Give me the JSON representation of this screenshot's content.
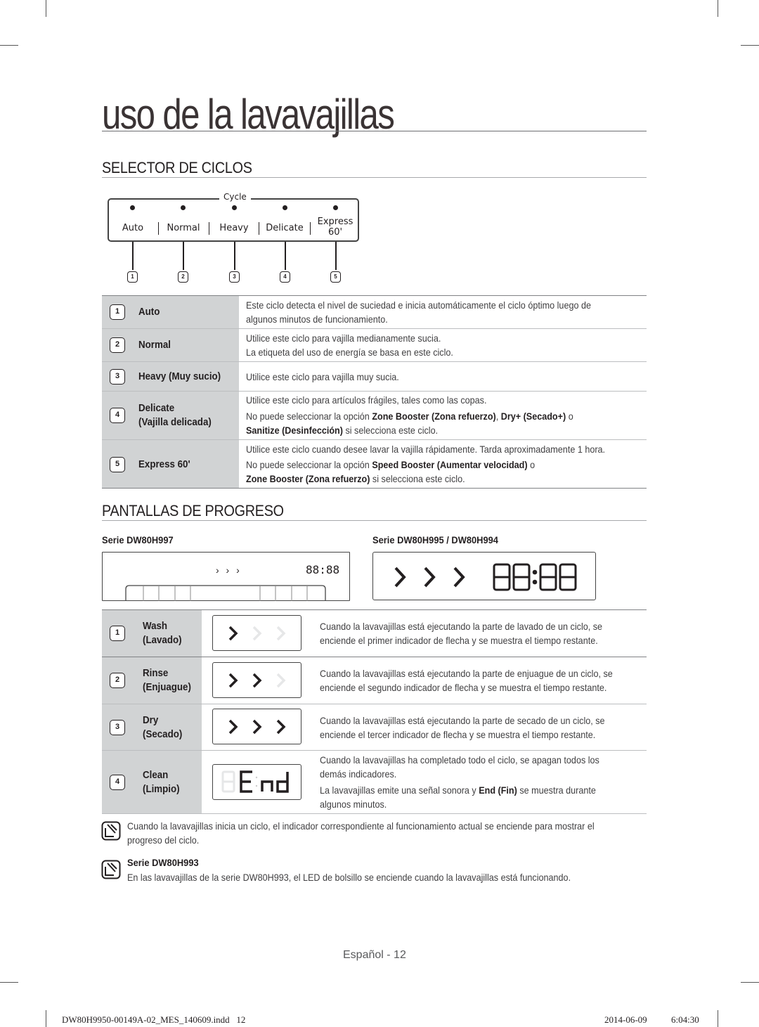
{
  "page": {
    "title": "uso de la lavavajillas",
    "footer_page": "Español - 12",
    "slug_file": "DW80H9950-00149A-02_MES_140609.indd   12",
    "slug_date": "2014-06-09",
    "slug_time": "6:04:30"
  },
  "selector": {
    "heading": "SELECTOR DE CICLOS",
    "panel_label": "Cycle",
    "buttons": [
      {
        "label": "Auto",
        "num": "1"
      },
      {
        "label": "Normal",
        "num": "2"
      },
      {
        "label": "Heavy",
        "num": "3"
      },
      {
        "label": "Delicate",
        "num": "4"
      },
      {
        "label": "Express",
        "label2": "60'",
        "num": "5"
      }
    ],
    "rows": [
      {
        "num": "1",
        "name": "Auto",
        "name2": "",
        "lines": [
          "Este ciclo detecta el nivel de suciedad e inicia automáticamente el ciclo óptimo luego de",
          "algunos minutos de funcionamiento."
        ]
      },
      {
        "num": "2",
        "name": "Normal",
        "name2": "",
        "lines": [
          "Utilice este ciclo para vajilla medianamente sucia.",
          "La etiqueta del uso de energía se basa en este ciclo."
        ]
      },
      {
        "num": "3",
        "name": "Heavy (Muy sucio)",
        "name2": "",
        "lines": [
          "Utilice este ciclo para vajilla muy sucia."
        ]
      },
      {
        "num": "4",
        "name": "Delicate",
        "name2": "(Vajilla delicada)",
        "lines": [
          "Utilice este ciclo para artículos frágiles, tales como las copas."
        ],
        "rich": {
          "l2_a": "No puede seleccionar la opción ",
          "l2_b": "Zone Booster (Zona refuerzo)",
          "l2_c": ", ",
          "l2_d": "Dry+ (Secado+)",
          "l2_e": " o",
          "l3_a": "Sanitize (Desinfección)",
          "l3_b": " si selecciona este ciclo."
        }
      },
      {
        "num": "5",
        "name": "Express 60'",
        "name2": "",
        "lines": [
          "Utilice este ciclo cuando desee lavar la vajilla rápidamente. Tarda aproximadamente 1 hora."
        ],
        "rich": {
          "l2_a": "No puede seleccionar la opción ",
          "l2_b": "Speed Booster (Aumentar velocidad)",
          "l2_c": " o",
          "l3_a": "Zone Booster (Zona refuerzo)",
          "l3_b": " si selecciona este ciclo."
        }
      }
    ]
  },
  "progress": {
    "heading": "PANTALLAS DE PROGRESO",
    "serie_a": "Serie DW80H997",
    "serie_b": "Serie DW80H995 / DW80H994",
    "display_small_arrows": "› › ›",
    "display_time": "88:88",
    "rows": [
      {
        "num": "1",
        "name": "Wash",
        "name2": "(Lavado)",
        "arrows_on": 1,
        "lines": [
          "Cuando la lavavajillas está ejecutando la parte de lavado de un ciclo, se",
          "enciende el primer indicador de flecha y se muestra el tiempo restante."
        ]
      },
      {
        "num": "2",
        "name": "Rinse",
        "name2": "(Enjuague)",
        "arrows_on": 2,
        "lines": [
          "Cuando la lavavajillas está ejecutando la parte de enjuague de un ciclo, se",
          "enciende el segundo indicador de flecha y se muestra el tiempo restante."
        ]
      },
      {
        "num": "3",
        "name": "Dry",
        "name2": "(Secado)",
        "arrows_on": 3,
        "lines": [
          "Cuando la lavavajillas está ejecutando la parte de secado de un ciclo, se",
          "enciende el tercer indicador de flecha y se muestra el tiempo restante."
        ]
      },
      {
        "num": "4",
        "name": "Clean",
        "name2": "(Limpio)",
        "display_text": "End",
        "lines": [
          "Cuando la lavavajillas ha completado todo el ciclo, se apagan todos los",
          "demás indicadores."
        ],
        "rich": {
          "a": "La lavavajillas emite una señal sonora y ",
          "b": "End (Fin)",
          "c": " se muestra durante",
          "d": "algunos minutos."
        }
      }
    ]
  },
  "notes": [
    {
      "icon": "note-icon",
      "lines": [
        "Cuando la lavavajillas inicia un ciclo, el indicador correspondiente al funcionamiento actual se enciende para mostrar el",
        "progreso del ciclo."
      ]
    },
    {
      "icon": "note-icon",
      "title": "Serie DW80H993",
      "lines": [
        "En las lavavajillas de la serie DW80H993, el LED de bolsillo se enciende cuando la lavavajillas está funcionando."
      ]
    }
  ]
}
